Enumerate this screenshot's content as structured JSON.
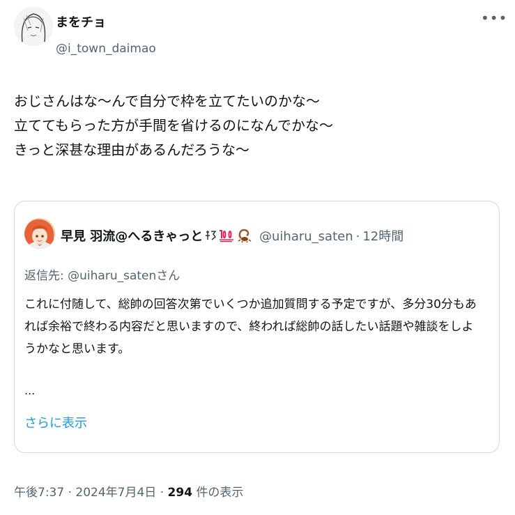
{
  "author": {
    "name": "まをチョ",
    "handle": "@i_town_daimao"
  },
  "tweet": {
    "lines": [
      "おじさんはな〜んで自分で枠を立てたいのかな〜",
      "立ててもらった方が手間を省けるのになんでかな〜",
      "きっと深甚な理由があるんだろうな〜"
    ]
  },
  "quote": {
    "name": "早見 羽流@へるきゃっと",
    "handle": "@uiharu_saten",
    "time": "12時間",
    "reply_prefix": "返信先: ",
    "reply_handle": "@uiharu_saten",
    "reply_suffix": "さん",
    "body_lines": [
      "これに付随して、総帥の回答次第でいくつか追加質問する予定ですが、多分30分もあ",
      "れば余裕で終わる内容だと思いますので、終われば総帥の話したい話題や雑談をしよ",
      "うかなと思います。"
    ],
    "ellipsis": "...",
    "show_more": "さらに表示"
  },
  "footer": {
    "time": "午後7:37",
    "date": "2024年7月4日",
    "views": "294",
    "views_label": "件の表示"
  },
  "icons": {
    "more": "more-horizontal-icon",
    "avatar": "sketch-portrait",
    "quote_avatar": "anime-portrait",
    "emoji": [
      "fire-kanji-badge",
      "hundred-points",
      "scorpion"
    ]
  }
}
